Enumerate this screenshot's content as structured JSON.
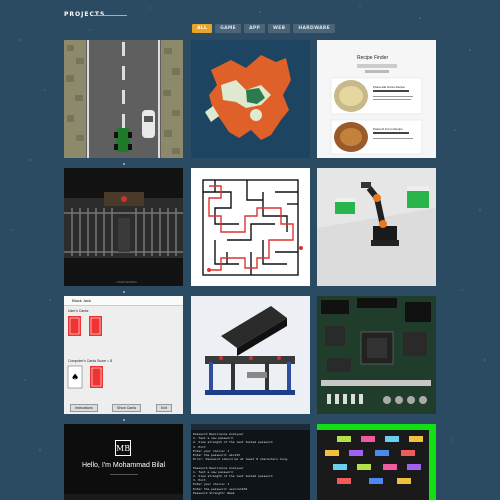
{
  "section": {
    "title": "PROJECTS"
  },
  "filters": [
    {
      "label": "ALL",
      "active": true
    },
    {
      "label": "GAME",
      "active": false
    },
    {
      "label": "APP",
      "active": false
    },
    {
      "label": "WEB",
      "active": false
    },
    {
      "label": "HARDWARE",
      "active": false
    }
  ],
  "projects": {
    "recipe": {
      "title": "Recipe Finder",
      "card1": "Pasta alla Gricia Recipe",
      "card2": "Pasta Al Forno Recipe"
    },
    "prison": {
      "caption": "YOUR WORLD"
    },
    "blackjack": {
      "window_title": "Black Jack",
      "user_cards": "User's Cards:",
      "computer_cards": "Computer's Cards Score = 8",
      "btn_instructions": "Instructions",
      "btn_show_cards": "Show Cards",
      "btn_exit": "Exit"
    },
    "portfolio": {
      "logo": "MB",
      "greeting": "Hello, I'm Mohammad Bilal"
    },
    "terminal": {
      "lines": [
        "Password Resilience Analyser",
        "1. Test a new password",
        "2. View strength of the last tested password",
        "3. Exit",
        "Enter your choice: 1",
        "Enter the password: abc123",
        "Error: Password should be at least 8 characters long.",
        "",
        "Password Resilience Analyser",
        "1. Test a new password",
        "2. View strength of the last tested password",
        "3. Exit",
        "Enter your choice: 1",
        "Enter the password: secure1234",
        "Password Strength: Weak"
      ]
    }
  },
  "colors": {
    "background": "#2b4b62",
    "accent": "#e8a52a",
    "filter_inactive": "#4b6478"
  }
}
